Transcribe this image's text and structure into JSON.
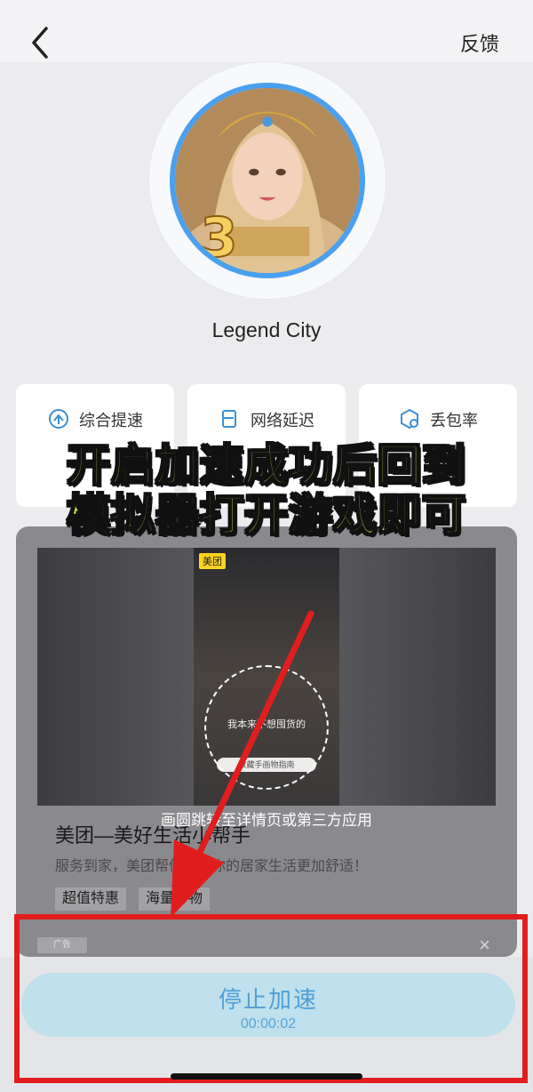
{
  "header": {
    "back_icon": "chevron-left-icon",
    "feedback_label": "反馈"
  },
  "game": {
    "name": "Legend City",
    "avatar_badge": "3RD ANN"
  },
  "stats": [
    {
      "label": "综合提速",
      "icon": "speed-up-icon"
    },
    {
      "label": "网络延迟",
      "icon": "latency-icon"
    },
    {
      "label": "丢包率",
      "icon": "packet-loss-icon"
    }
  ],
  "overlay_caption": {
    "line1": "开启加速成功后回到",
    "line2": "模拟器打开游戏即可"
  },
  "ad": {
    "brand_tag": "美团",
    "video_subtitle": "我本来不想囤货的",
    "video_search": "收藏手画物指南",
    "hint": "画圆跳转至详情页或第三方应用",
    "title": "美团—美好生活小帮手",
    "description": "服务到家，美团帮你，让你的居家生活更加舒适！",
    "tags": [
      "超值特惠",
      "海量好物"
    ],
    "ad_mark": "广告",
    "close_icon": "close-icon"
  },
  "action": {
    "stop_label": "停止加速",
    "timer": "00:00:02"
  },
  "colors": {
    "accent": "#4aa0ee",
    "caption": "#c7f24a",
    "highlight": "#e21d1d",
    "button_bg": "#bfe0ec"
  }
}
